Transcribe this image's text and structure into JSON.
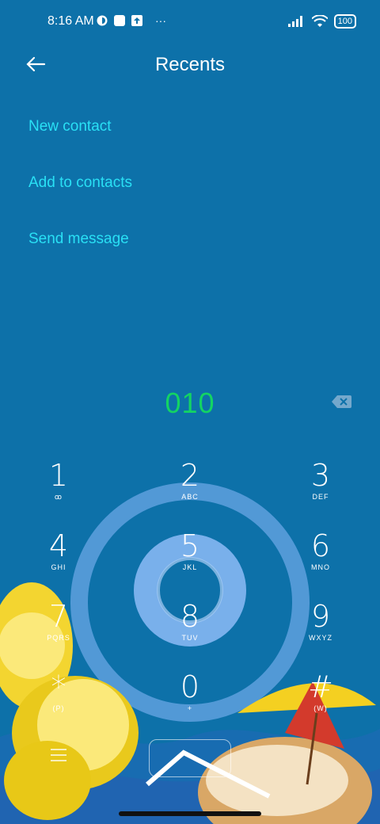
{
  "status_bar": {
    "time": "8:16 AM",
    "dots": "···",
    "battery": "100"
  },
  "header": {
    "title": "Recents"
  },
  "menu": [
    {
      "label": "New contact"
    },
    {
      "label": "Add to contacts"
    },
    {
      "label": "Send message"
    }
  ],
  "dialer": {
    "number": "010",
    "keys": [
      {
        "digit": "1",
        "letters": "ꝏ"
      },
      {
        "digit": "2",
        "letters": "ABC"
      },
      {
        "digit": "3",
        "letters": "DEF"
      },
      {
        "digit": "4",
        "letters": "GHI"
      },
      {
        "digit": "5",
        "letters": "JKL"
      },
      {
        "digit": "6",
        "letters": "MNO"
      },
      {
        "digit": "7",
        "letters": "PQRS"
      },
      {
        "digit": "8",
        "letters": "TUV"
      },
      {
        "digit": "9",
        "letters": "WXYZ"
      },
      {
        "digit": "*",
        "letters": "(P)"
      },
      {
        "digit": "0",
        "letters": "+"
      },
      {
        "digit": "#",
        "letters": "(W)"
      }
    ]
  },
  "colors": {
    "background": "#0d71a9",
    "accent": "#29e0f5",
    "number": "#13d463"
  }
}
